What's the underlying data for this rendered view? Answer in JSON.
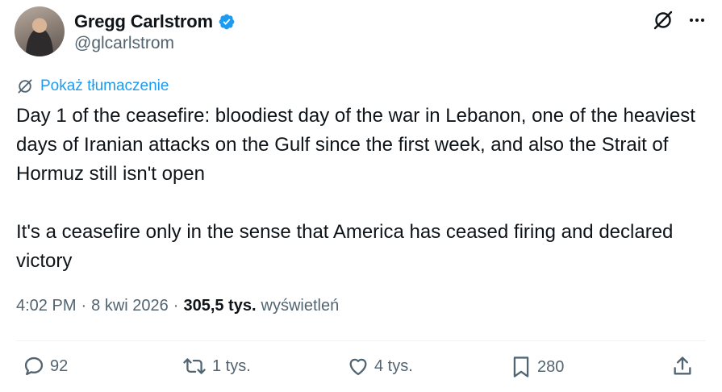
{
  "author": {
    "name": "Gregg Carlstrom",
    "handle": "@glcarlstrom"
  },
  "translate_label": "Pokaż tłumaczenie",
  "tweet": {
    "paragraph1": "Day 1 of the ceasefire: bloodiest day of the war in Lebanon, one of the heaviest days of Iranian attacks on the Gulf since the first week, and also the Strait of Hormuz still isn't open",
    "paragraph2": "It's a ceasefire only in the sense that America has ceased firing and declared victory"
  },
  "meta": {
    "time": "4:02 PM",
    "date": "8 kwi 2026",
    "views_count": "305,5 tys.",
    "views_label": "wyświetleń",
    "separator": "·"
  },
  "actions": {
    "replies": "92",
    "reposts": "1 tys.",
    "likes": "4 tys.",
    "bookmarks": "280"
  },
  "icons": {
    "verified": "verified-badge-icon",
    "grok": "grok-icon",
    "more": "more-icon",
    "reply": "reply-icon",
    "repost": "repost-icon",
    "like": "like-icon",
    "bookmark": "bookmark-icon",
    "share": "share-icon"
  },
  "colors": {
    "accent": "#1d9bf0",
    "secondary_text": "#536471",
    "primary_text": "#0f1419"
  }
}
